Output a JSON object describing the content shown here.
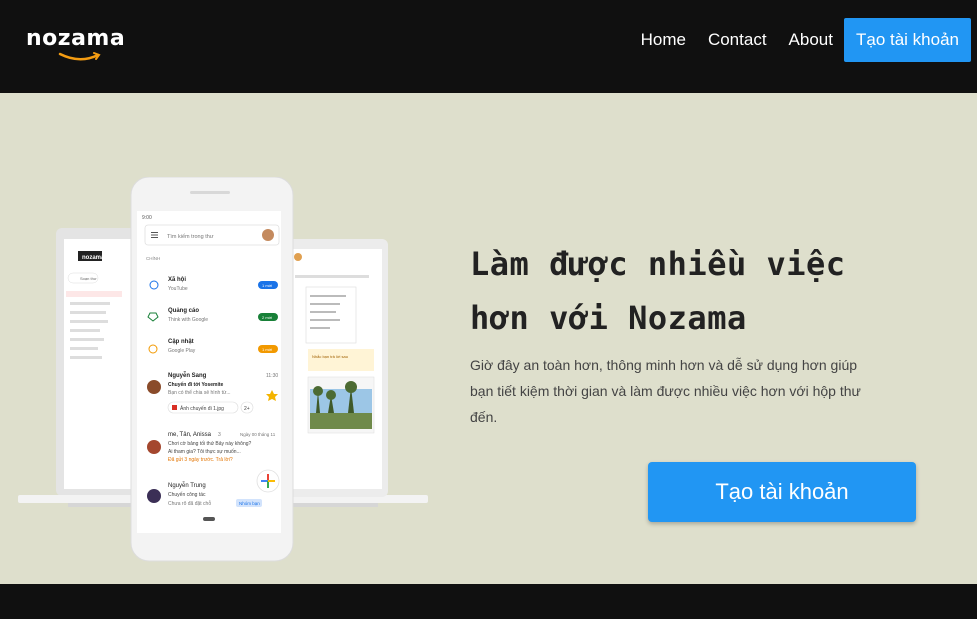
{
  "brand": {
    "name": "nozama"
  },
  "nav": {
    "home": "Home",
    "contact": "Contact",
    "about": "About",
    "signup": "Tạo tài khoản"
  },
  "hero": {
    "headline": "Làm được nhiều việc hơn với Nozama",
    "description": "Giờ đây an toàn hơn, thông minh hơn và dễ sử dụng hơn giúp bạn tiết kiệm thời gian và làm được nhiều việc hơn với hộp thư đến.",
    "cta": "Tạo tài khoản"
  },
  "phone": {
    "time": "9:00",
    "search_placeholder": "Tìm kiếm trong thư",
    "section": "CHÍNH",
    "categories": [
      {
        "title": "Xã hội",
        "sub": "YouTube",
        "badge": "1 mới",
        "color": "#1a73e8"
      },
      {
        "title": "Quảng cáo",
        "sub": "Think with Google",
        "badge": "2 mới",
        "color": "#188038"
      },
      {
        "title": "Cập nhật",
        "sub": "Google Play",
        "badge": "1 mới",
        "color": "#f29900"
      }
    ],
    "mails": [
      {
        "from": "Nguyễn Sang",
        "time": "11:30",
        "subject": "Chuyến đi tới Yosemite",
        "snippet": "Bạn có thể chia sẻ hình từ...",
        "attachment": "Ảnh chuyến đi 1.jpg",
        "more": "2+"
      },
      {
        "from": "me, Tân, Anissa",
        "count": "3",
        "time": "Ngày 00 tháng 11",
        "subject": "Chơi cờ bảng tối thứ Bảy này không?",
        "snippet": "Ai tham gia? Tôi thực sự muốn...",
        "note": "Đã gửi 3 ngày trước. Trả lời?"
      },
      {
        "from": "Nguyễn Trung",
        "subject": "Chuyến công tác",
        "snippet": "Chưa rõ đã đặt chỗ",
        "tag": "Nhóm bạn"
      }
    ]
  },
  "laptop": {
    "brand": "nozama",
    "compose": "Soạn thư"
  },
  "tablet": {
    "note": "Nhắc bạn trả lời sau"
  }
}
